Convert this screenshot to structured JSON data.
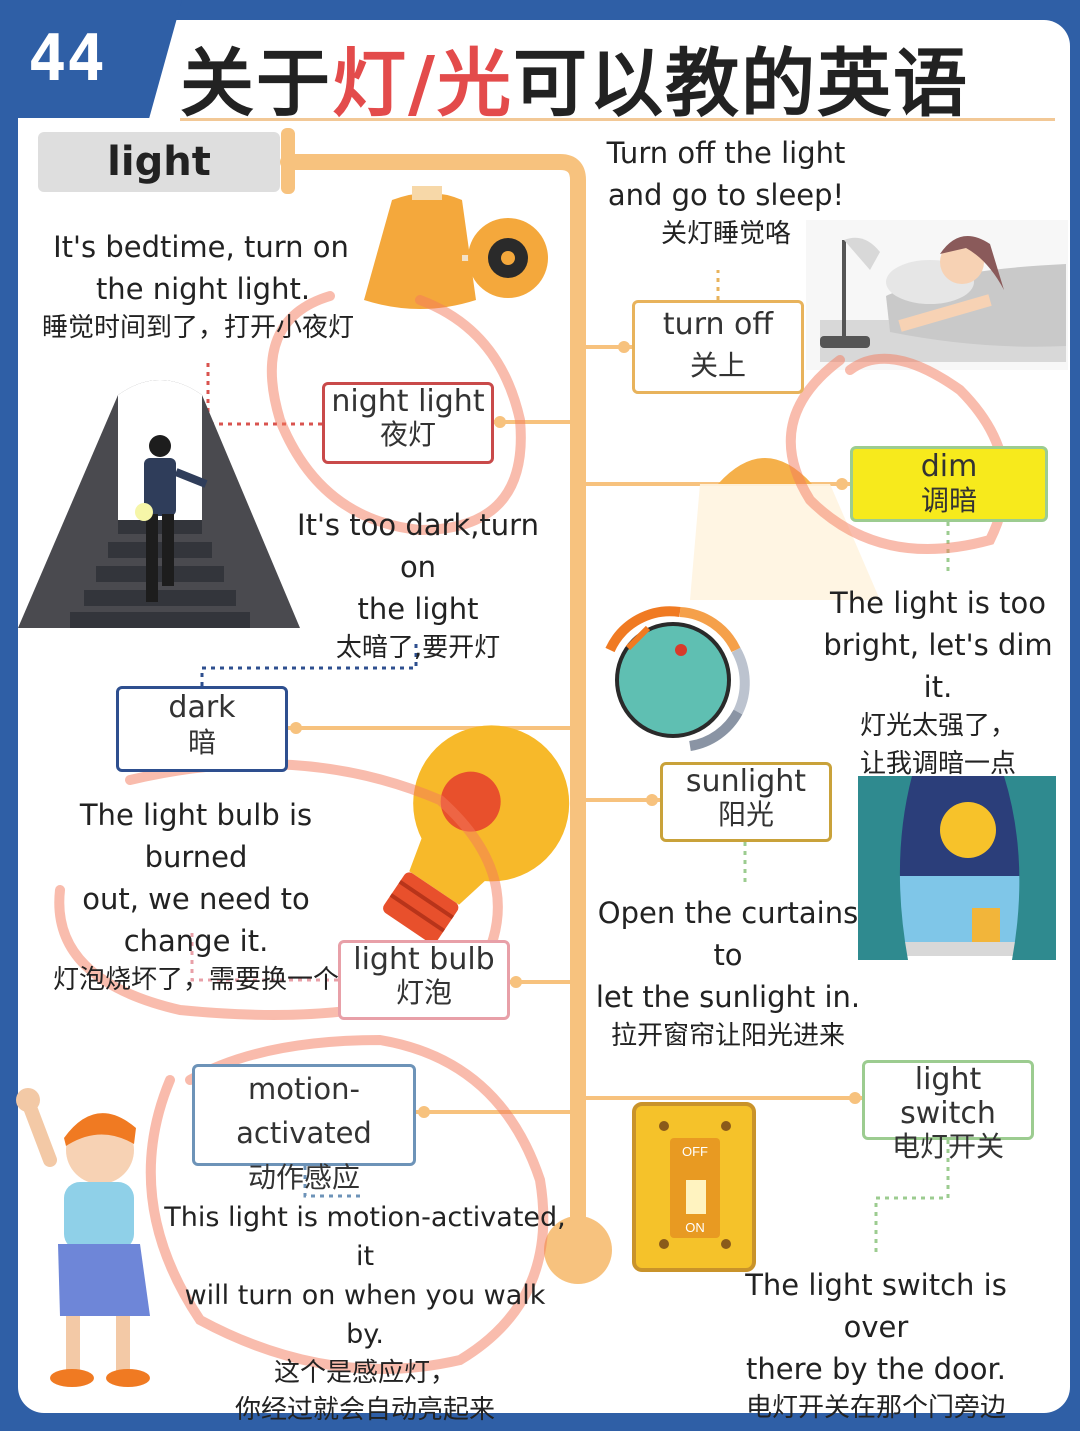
{
  "badge": "44",
  "title": {
    "part1": "关于",
    "highlight": "灯/光",
    "part2": "可以教的英语"
  },
  "header": "light",
  "vocab": {
    "night_light": {
      "en": "night light",
      "zh": "夜灯"
    },
    "dark": {
      "en": "dark",
      "zh": "暗"
    },
    "light_bulb": {
      "en": "light bulb",
      "zh": "灯泡"
    },
    "motion_activated": {
      "en": "motion-activated",
      "zh": "动作感应"
    },
    "turn_off": {
      "en": "turn off",
      "zh": "关上"
    },
    "dim": {
      "en": "dim",
      "zh": "调暗"
    },
    "sunlight": {
      "en": "sunlight",
      "zh": "阳光"
    },
    "light_switch": {
      "en": "light switch",
      "zh": "电灯开关"
    }
  },
  "sentences": {
    "night_light": {
      "en1": "It's bedtime, turn on",
      "en2": "the night light.",
      "zh1": "睡觉时间到了，打开小夜灯"
    },
    "dark": {
      "en1": "It's too dark,turn on",
      "en2": "the light",
      "zh1": "太暗了,要开灯"
    },
    "light_bulb": {
      "en1": "The light bulb is burned",
      "en2": "out, we need to change it.",
      "zh1": "灯泡烧坏了，需要换一个"
    },
    "motion_activated": {
      "en1": "This light is motion-activated, it",
      "en2": "will turn on when you walk by.",
      "zh1": "这个是感应灯，",
      "zh2": "你经过就会自动亮起来"
    },
    "turn_off": {
      "en1": "Turn off the light",
      "en2": "and go to sleep!",
      "zh1": "关灯睡觉咯"
    },
    "dim": {
      "en1": "The light is too",
      "en2": "bright, let's dim it.",
      "zh1": "灯光太强了，",
      "zh2": "让我调暗一点"
    },
    "sunlight": {
      "en1": "Open the curtains to",
      "en2": "let the sunlight in.",
      "zh1": "拉开窗帘让阳光进来"
    },
    "light_switch": {
      "en1": "The light switch is over",
      "en2": "there by the door.",
      "zh1": "电灯开关在那个门旁边"
    }
  },
  "switch_labels": {
    "off": "OFF",
    "on": "ON"
  },
  "colors": {
    "frame": "#2f5fa6",
    "trunk": "#f7c27e",
    "title_highlight": "#e34b4b",
    "box_red": "#c94a4a",
    "box_blue": "#2e4f8f",
    "box_gold": "#e8b35c",
    "box_pink": "#e8a0a8",
    "box_green": "#9ccc90",
    "dim_fill": "#f7ea1c",
    "annotation": "#f47a5c"
  },
  "icons": [
    "wall-lamp-icon",
    "person-stairs-flashlight-icon",
    "light-bulb-icon",
    "waving-child-icon",
    "sleeping-woman-lamp-icon",
    "ceiling-lamp-glow-icon",
    "dimmer-knob-icon",
    "window-sun-curtains-icon",
    "wall-switch-icon"
  ]
}
